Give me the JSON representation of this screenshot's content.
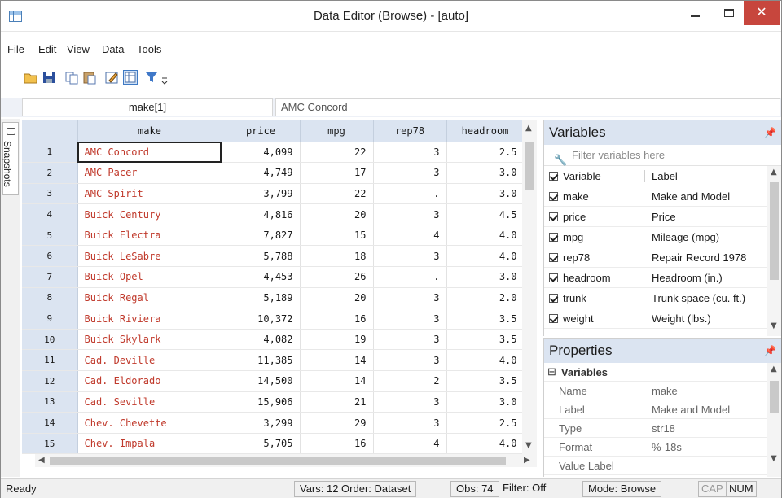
{
  "window": {
    "title": "Data Editor (Browse) - [auto]",
    "min": "—",
    "close": "✕"
  },
  "menu": [
    "File",
    "Edit",
    "View",
    "Data",
    "Tools"
  ],
  "toolbar_icons": [
    "open-icon",
    "save-icon",
    "copy-icon",
    "paste-icon",
    "edit-mode-icon",
    "browse-mode-icon",
    "filter-icon",
    "more-icon"
  ],
  "varbar": {
    "name": "make[1]",
    "value": "AMC Concord"
  },
  "snapshots": {
    "label": "Snapshots"
  },
  "grid": {
    "columns": [
      "make",
      "price",
      "mpg",
      "rep78",
      "headroom"
    ],
    "rows": [
      {
        "n": "1",
        "make": "AMC Concord",
        "price": "4,099",
        "mpg": "22",
        "rep78": "3",
        "headroom": "2.5"
      },
      {
        "n": "2",
        "make": "AMC Pacer",
        "price": "4,749",
        "mpg": "17",
        "rep78": "3",
        "headroom": "3.0"
      },
      {
        "n": "3",
        "make": "AMC Spirit",
        "price": "3,799",
        "mpg": "22",
        "rep78": ".",
        "headroom": "3.0"
      },
      {
        "n": "4",
        "make": "Buick Century",
        "price": "4,816",
        "mpg": "20",
        "rep78": "3",
        "headroom": "4.5"
      },
      {
        "n": "5",
        "make": "Buick Electra",
        "price": "7,827",
        "mpg": "15",
        "rep78": "4",
        "headroom": "4.0"
      },
      {
        "n": "6",
        "make": "Buick LeSabre",
        "price": "5,788",
        "mpg": "18",
        "rep78": "3",
        "headroom": "4.0"
      },
      {
        "n": "7",
        "make": "Buick Opel",
        "price": "4,453",
        "mpg": "26",
        "rep78": ".",
        "headroom": "3.0"
      },
      {
        "n": "8",
        "make": "Buick Regal",
        "price": "5,189",
        "mpg": "20",
        "rep78": "3",
        "headroom": "2.0"
      },
      {
        "n": "9",
        "make": "Buick Riviera",
        "price": "10,372",
        "mpg": "16",
        "rep78": "3",
        "headroom": "3.5"
      },
      {
        "n": "10",
        "make": "Buick Skylark",
        "price": "4,082",
        "mpg": "19",
        "rep78": "3",
        "headroom": "3.5"
      },
      {
        "n": "11",
        "make": "Cad. Deville",
        "price": "11,385",
        "mpg": "14",
        "rep78": "3",
        "headroom": "4.0"
      },
      {
        "n": "12",
        "make": "Cad. Eldorado",
        "price": "14,500",
        "mpg": "14",
        "rep78": "2",
        "headroom": "3.5"
      },
      {
        "n": "13",
        "make": "Cad. Seville",
        "price": "15,906",
        "mpg": "21",
        "rep78": "3",
        "headroom": "3.0"
      },
      {
        "n": "14",
        "make": "Chev. Chevette",
        "price": "3,299",
        "mpg": "29",
        "rep78": "3",
        "headroom": "2.5"
      },
      {
        "n": "15",
        "make": "Chev. Impala",
        "price": "5,705",
        "mpg": "16",
        "rep78": "4",
        "headroom": "4.0"
      }
    ]
  },
  "variables": {
    "title": "Variables",
    "filter_placeholder": "Filter variables here",
    "col_variable": "Variable",
    "col_label": "Label",
    "items": [
      {
        "name": "make",
        "label": "Make and Model"
      },
      {
        "name": "price",
        "label": "Price"
      },
      {
        "name": "mpg",
        "label": "Mileage (mpg)"
      },
      {
        "name": "rep78",
        "label": "Repair Record 1978"
      },
      {
        "name": "headroom",
        "label": "Headroom (in.)"
      },
      {
        "name": "trunk",
        "label": "Trunk space (cu. ft.)"
      },
      {
        "name": "weight",
        "label": "Weight (lbs.)"
      }
    ]
  },
  "properties": {
    "title": "Properties",
    "section": "Variables",
    "items": [
      {
        "key": "Name",
        "value": "make"
      },
      {
        "key": "Label",
        "value": "Make and Model"
      },
      {
        "key": "Type",
        "value": "str18"
      },
      {
        "key": "Format",
        "value": "%-18s"
      },
      {
        "key": "Value Label",
        "value": ""
      }
    ]
  },
  "status": {
    "ready": "Ready",
    "vars": "Vars: 12 Order: Dataset",
    "obs": "Obs: 74",
    "filter": "Filter: Off",
    "mode": "Mode: Browse",
    "cap": "CAP",
    "num": "NUM"
  }
}
